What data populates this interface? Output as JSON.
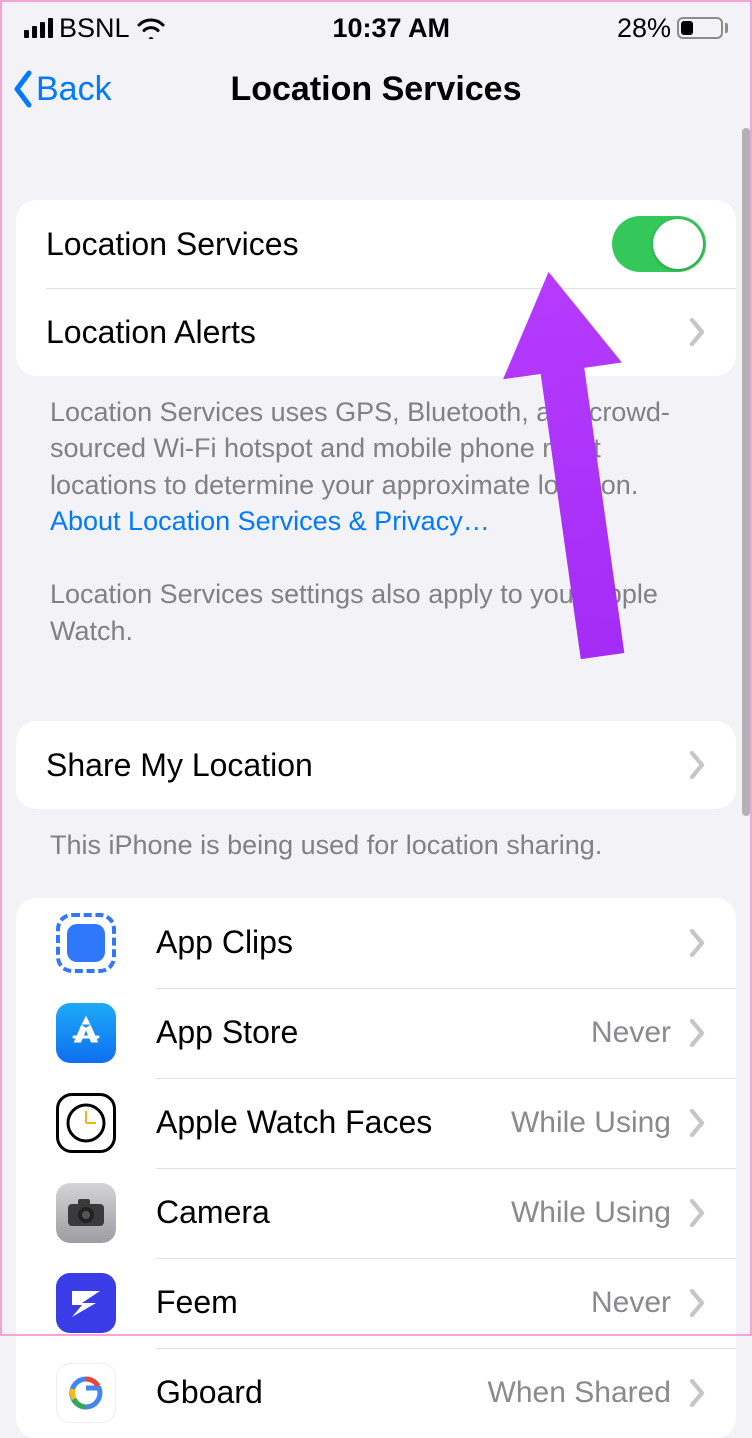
{
  "status_bar": {
    "carrier": "BSNL",
    "time": "10:37 AM",
    "battery_pct": "28%"
  },
  "nav": {
    "back_label": "Back",
    "title": "Location Services"
  },
  "group1": {
    "location_services_label": "Location Services",
    "location_services_on": true,
    "location_alerts_label": "Location Alerts"
  },
  "footer1": {
    "text_a": "Location Services uses GPS, Bluetooth, and crowd-sourced Wi-Fi hotspot and mobile phone mast locations to determine your approximate location. ",
    "link": "About Location Services & Privacy…",
    "text_b": "Location Services settings also apply to your Apple Watch."
  },
  "group2": {
    "share_label": "Share My Location"
  },
  "footer2": {
    "text": "This iPhone is being used for location sharing."
  },
  "apps": [
    {
      "name": "App Clips",
      "status": "",
      "icon": "appclips"
    },
    {
      "name": "App Store",
      "status": "Never",
      "icon": "appstore"
    },
    {
      "name": "Apple Watch Faces",
      "status": "While Using",
      "icon": "watch"
    },
    {
      "name": "Camera",
      "status": "While Using",
      "icon": "camera"
    },
    {
      "name": "Feem",
      "status": "Never",
      "icon": "feem"
    },
    {
      "name": "Gboard",
      "status": "When Shared",
      "icon": "gboard"
    }
  ]
}
